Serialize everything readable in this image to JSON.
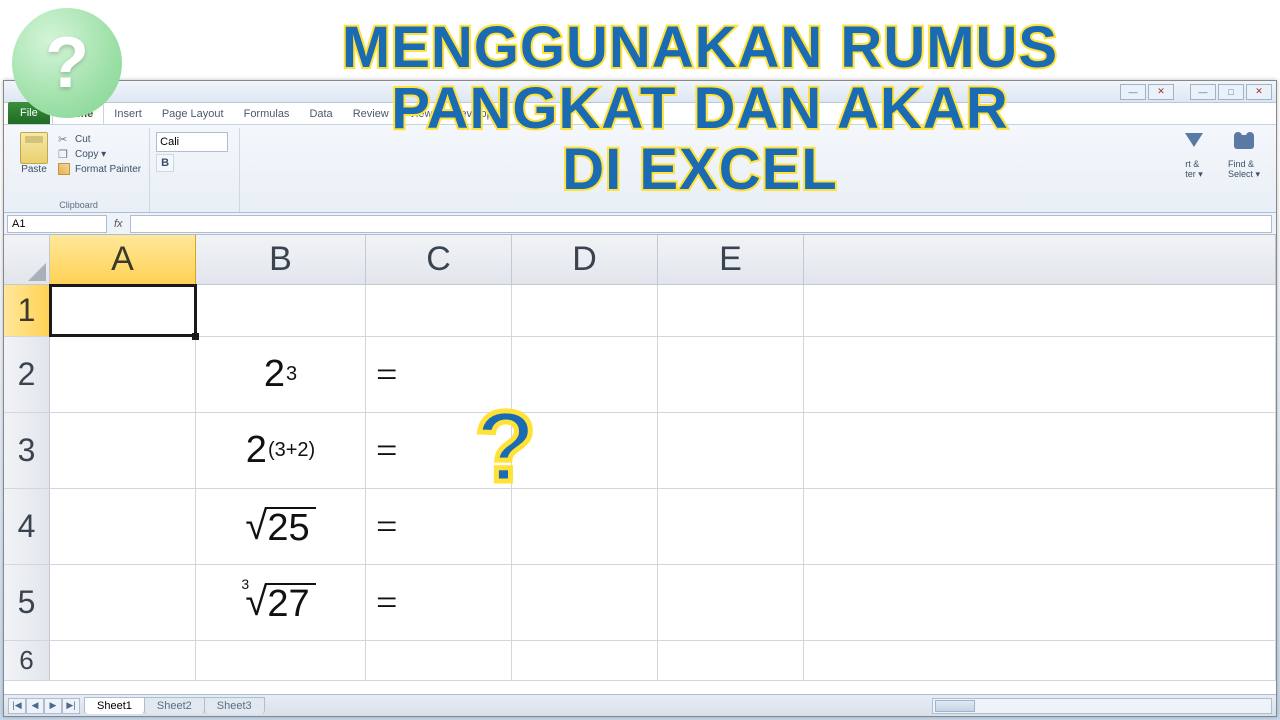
{
  "logo": {
    "mark": "?"
  },
  "title": {
    "l1": "MENGGUNAKAN RUMUS",
    "l2": "PANGKAT DAN AKAR",
    "l3": "DI EXCEL"
  },
  "overlay_qmark": "?",
  "window": {
    "min": "—",
    "max": "□",
    "close": "✕",
    "sub_min": "—",
    "sub_close": "✕"
  },
  "tabs": {
    "file": "File",
    "list": [
      "Home",
      "Insert",
      "Page Layout",
      "Formulas",
      "Data",
      "Review",
      "View",
      "Developer"
    ],
    "active": "Home"
  },
  "clipboard": {
    "group": "Clipboard",
    "paste": "Paste",
    "cut": "Cut",
    "copy": "Copy ▾",
    "fmt": "Format Painter"
  },
  "font": {
    "name": "Cali",
    "bold": "B"
  },
  "editing": {
    "sort": "rt &\nter ▾",
    "find": "Find &\nSelect ▾"
  },
  "namebox": "A1",
  "fx": "fx",
  "cols": [
    "A",
    "B",
    "C",
    "D",
    "E"
  ],
  "rows": [
    "1",
    "2",
    "3",
    "4",
    "5",
    "6"
  ],
  "cells": {
    "b2_base": "2",
    "b2_exp": "3",
    "c2": "=",
    "b3_base": "2",
    "b3_exp": "(3+2)",
    "c3": "=",
    "b4_rad": "25",
    "c4": "=",
    "b5_idx": "3",
    "b5_rad": "27",
    "c5": "="
  },
  "sheets": {
    "nav": [
      "|◀",
      "◀",
      "▶",
      "▶|"
    ],
    "tabs": [
      "Sheet1",
      "Sheet2",
      "Sheet3"
    ]
  }
}
